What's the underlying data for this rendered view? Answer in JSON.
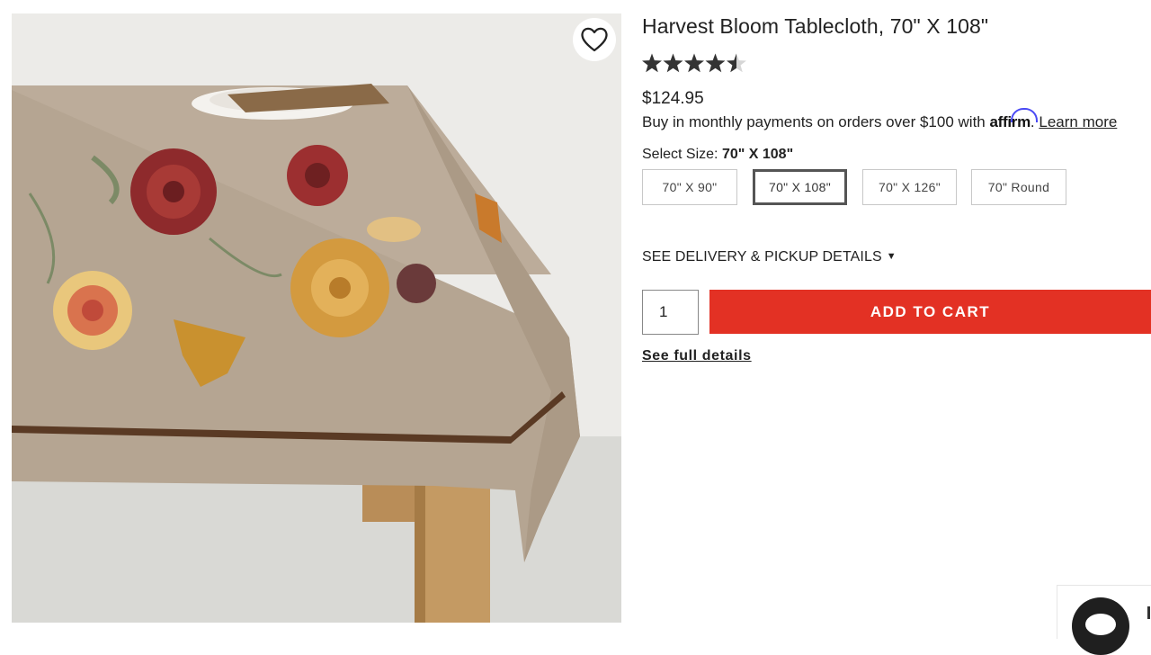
{
  "product": {
    "title": "Harvest Bloom Tablecloth, 70\" X 108\"",
    "rating_value": 4.5,
    "rating_max": 5,
    "price": "$124.95",
    "image_alt": "product-image"
  },
  "affirm": {
    "text_before": "Buy in monthly payments on orders over $100 with ",
    "logo_text": "affirm",
    "text_after": ". ",
    "learn_more": "Learn more"
  },
  "size": {
    "label": "Select Size: ",
    "selected_value": "70\" X 108\"",
    "options": [
      "70\" X 90\"",
      "70\" X 108\"",
      "70\" X 126\"",
      "70\" Round"
    ]
  },
  "delivery": {
    "label": "SEE DELIVERY & PICKUP DETAILS",
    "caret": "▼"
  },
  "cart": {
    "quantity": "1",
    "add_to_cart": "ADD TO CART",
    "full_details": "See full details"
  },
  "colors": {
    "accent": "#e33124",
    "affirm_arc": "#4a4af4",
    "selected_border": "#555555",
    "tablecloth": "#b7a795",
    "border_stripe": "#5a3a24"
  },
  "icons": {
    "favorite": "heart-outline-icon",
    "rating": "star-icon",
    "chat": "chat-bubble-icon"
  }
}
